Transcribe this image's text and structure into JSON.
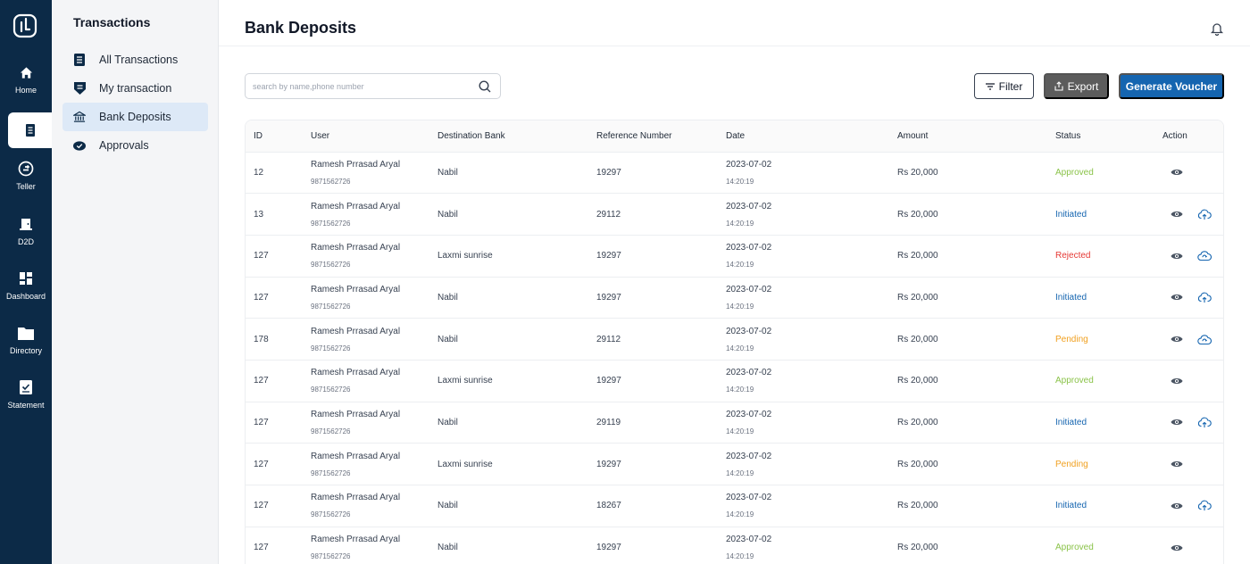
{
  "rail": {
    "items": [
      {
        "label": "Home",
        "icon": "home-icon"
      },
      {
        "label": "",
        "icon": "receipt-icon",
        "active": true
      },
      {
        "label": "Teller",
        "icon": "teller-icon"
      },
      {
        "label": "D2D",
        "icon": "d2d-icon"
      },
      {
        "label": "Dashboard",
        "icon": "dashboard-icon"
      },
      {
        "label": "Directory",
        "icon": "folder-icon"
      },
      {
        "label": "Statement",
        "icon": "statement-icon"
      }
    ]
  },
  "subnav": {
    "title": "Transactions",
    "items": [
      {
        "label": "All Transactions",
        "icon": "list-icon"
      },
      {
        "label": "My transaction",
        "icon": "shield-icon"
      },
      {
        "label": "Bank Deposits",
        "icon": "bank-icon",
        "active": true
      },
      {
        "label": "Approvals",
        "icon": "approval-icon"
      }
    ]
  },
  "header": {
    "title": "Bank Deposits"
  },
  "toolbar": {
    "search_placeholder": "search by name,phone number",
    "filter_label": "Filter",
    "export_label": "Export",
    "generate_label": "Generate Voucher"
  },
  "colors": {
    "rail_bg": "#0c2a47",
    "primary": "#1565b0",
    "approved": "#8bc34a",
    "initiated": "#1565b0",
    "rejected": "#e53935",
    "pending": "#f0a020"
  },
  "table": {
    "columns": [
      "ID",
      "User",
      "Destination Bank",
      "Reference Number",
      "Date",
      "Amount",
      "Status",
      "Action"
    ],
    "rows": [
      {
        "id": "12",
        "name": "Ramesh Prrasad Aryal",
        "phone": "9871562726",
        "bank": "Nabil",
        "ref": "19297",
        "date": "2023-07-02",
        "time": "14:20:19",
        "amount": "Rs 20,000",
        "status": "Approved",
        "action2": ""
      },
      {
        "id": "13",
        "name": "Ramesh Prrasad Aryal",
        "phone": "9871562726",
        "bank": "Nabil",
        "ref": "29112",
        "date": "2023-07-02",
        "time": "14:20:19",
        "amount": "Rs 20,000",
        "status": "Initiated",
        "action2": "upload-cloud-icon"
      },
      {
        "id": "127",
        "name": "Ramesh Prrasad Aryal",
        "phone": "9871562726",
        "bank": "Laxmi sunrise",
        "ref": "19297",
        "date": "2023-07-02",
        "time": "14:20:19",
        "amount": "Rs 20,000",
        "status": "Rejected",
        "action2": "cloud-sync-icon"
      },
      {
        "id": "127",
        "name": "Ramesh Prrasad Aryal",
        "phone": "9871562726",
        "bank": "Nabil",
        "ref": "19297",
        "date": "2023-07-02",
        "time": "14:20:19",
        "amount": "Rs 20,000",
        "status": "Initiated",
        "action2": "upload-cloud-icon"
      },
      {
        "id": "178",
        "name": "Ramesh Prrasad Aryal",
        "phone": "9871562726",
        "bank": "Nabil",
        "ref": "29112",
        "date": "2023-07-02",
        "time": "14:20:19",
        "amount": "Rs 20,000",
        "status": "Pending",
        "action2": "cloud-sync-icon"
      },
      {
        "id": "127",
        "name": "Ramesh Prrasad Aryal",
        "phone": "9871562726",
        "bank": "Laxmi sunrise",
        "ref": "19297",
        "date": "2023-07-02",
        "time": "14:20:19",
        "amount": "Rs 20,000",
        "status": "Approved",
        "action2": ""
      },
      {
        "id": "127",
        "name": "Ramesh Prrasad Aryal",
        "phone": "9871562726",
        "bank": "Nabil",
        "ref": "29119",
        "date": "2023-07-02",
        "time": "14:20:19",
        "amount": "Rs 20,000",
        "status": "Initiated",
        "action2": "upload-cloud-icon"
      },
      {
        "id": "127",
        "name": "Ramesh Prrasad Aryal",
        "phone": "9871562726",
        "bank": "Laxmi sunrise",
        "ref": "19297",
        "date": "2023-07-02",
        "time": "14:20:19",
        "amount": "Rs 20,000",
        "status": "Pending",
        "action2": ""
      },
      {
        "id": "127",
        "name": "Ramesh Prrasad Aryal",
        "phone": "9871562726",
        "bank": "Nabil",
        "ref": "18267",
        "date": "2023-07-02",
        "time": "14:20:19",
        "amount": "Rs 20,000",
        "status": "Initiated",
        "action2": "upload-cloud-icon"
      },
      {
        "id": "127",
        "name": "Ramesh Prrasad Aryal",
        "phone": "9871562726",
        "bank": "Nabil",
        "ref": "19297",
        "date": "2023-07-02",
        "time": "14:20:19",
        "amount": "Rs 20,000",
        "status": "Approved",
        "action2": ""
      }
    ]
  }
}
